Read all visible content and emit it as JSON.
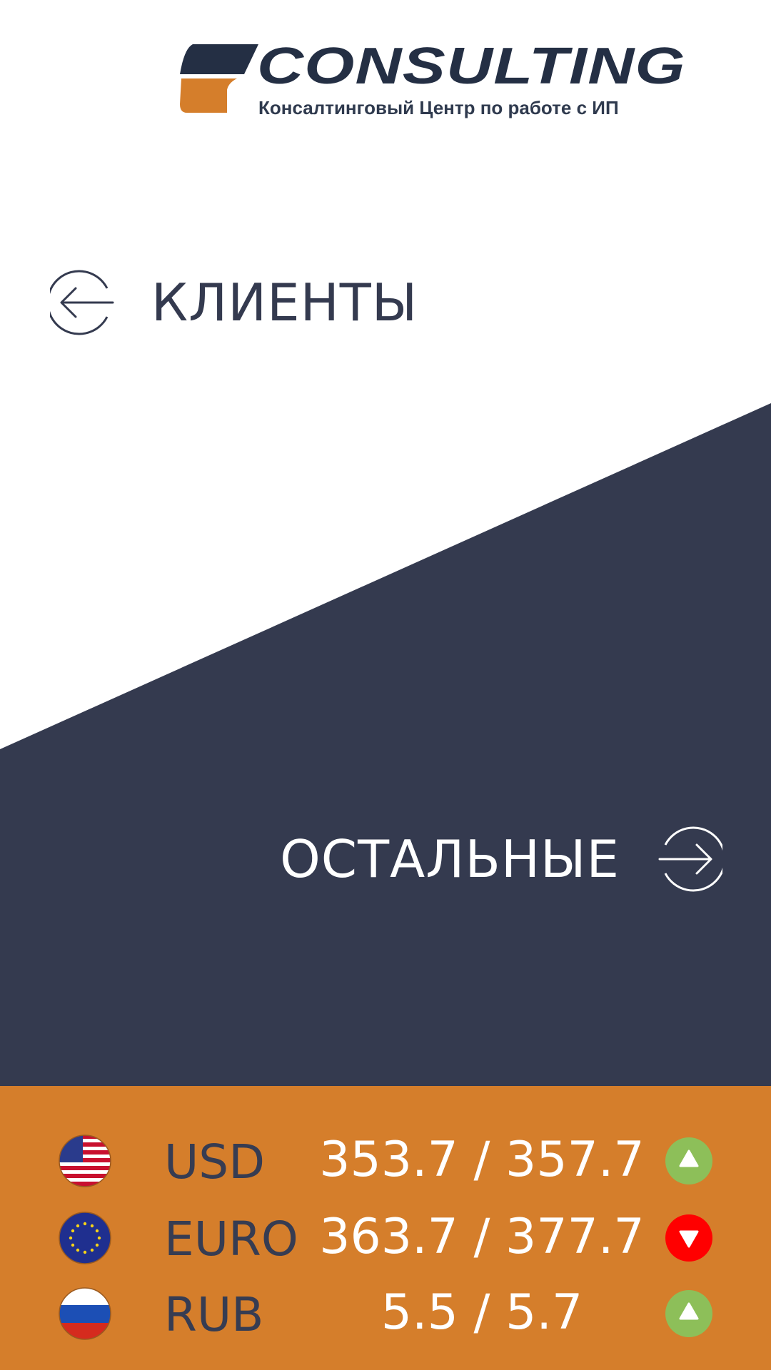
{
  "logo": {
    "title": "CONSULTING",
    "subtitle": "Консалтинговый Центр по работе с ИП"
  },
  "nav": {
    "clients_label": "КЛИЕНТЫ",
    "others_label": "ОСТАЛЬНЫЕ"
  },
  "colors": {
    "navy": "#343a4f",
    "orange": "#d57e2b",
    "up": "#8dbf59",
    "down": "#ff0000"
  },
  "rates": [
    {
      "currency": "USD",
      "value": "353.7 / 357.7",
      "trend": "up",
      "flag": "us-flag-icon"
    },
    {
      "currency": "EURO",
      "value": "363.7 / 377.7",
      "trend": "down",
      "flag": "eu-flag-icon"
    },
    {
      "currency": "RUB",
      "value": "5.5 / 5.7",
      "trend": "up",
      "flag": "ru-flag-icon"
    }
  ]
}
